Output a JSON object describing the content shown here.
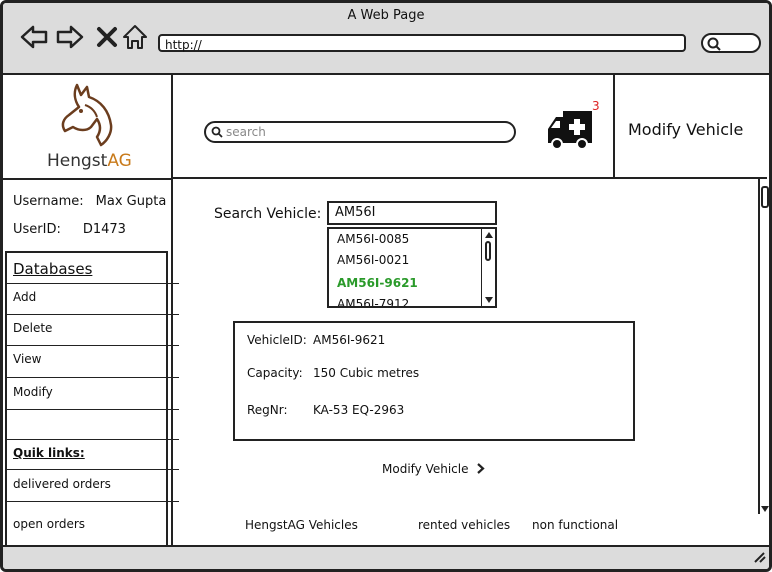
{
  "browser": {
    "window_title": "A Web Page",
    "url": "http://"
  },
  "logo": {
    "brand_prefix": "Hengst",
    "brand_suffix": "AG"
  },
  "header": {
    "search_placeholder": "search",
    "notification_count": "3",
    "page_title": "Modify Vehicle"
  },
  "user": {
    "username_label": "Username:",
    "username_value": "Max Gupta",
    "userid_label": "UserID:",
    "userid_value": "D1473"
  },
  "sidebar": {
    "databases_title": "Databases",
    "items": [
      "Add",
      "Delete",
      "View",
      "Modify"
    ],
    "quicklinks_title": "Quik links:",
    "quicklinks": [
      "delivered orders",
      "open orders"
    ]
  },
  "search_vehicle": {
    "label": "Search Vehicle:",
    "value": "AM56I",
    "options": [
      "AM56I-0085",
      "AM56I-0021",
      "AM56I-9621",
      "AM56I-7912"
    ],
    "selected": "AM56I-9621"
  },
  "vehicle": {
    "id_label": "VehicleID:",
    "id_value": "AM56I-9621",
    "capacity_label": "Capacity:",
    "capacity_value": "150 Cubic metres",
    "reg_label": "RegNr:",
    "reg_value": "KA-53 EQ-2963"
  },
  "actions": {
    "modify_label": "Modify Vehicle"
  },
  "footer": {
    "links": [
      "HengstAG Vehicles",
      "rented vehicles",
      "non functional"
    ]
  },
  "colors": {
    "chrome": "#dcdcdc",
    "selected": "#2a9a2a",
    "brand_accent": "#c87a1a",
    "badge": "#d22222"
  },
  "icons": [
    "back-arrow-icon",
    "forward-arrow-icon",
    "close-icon",
    "home-icon",
    "search-icon",
    "ambulance-icon",
    "chevron-right-icon",
    "horse-logo-icon",
    "resize-grip-icon"
  ]
}
